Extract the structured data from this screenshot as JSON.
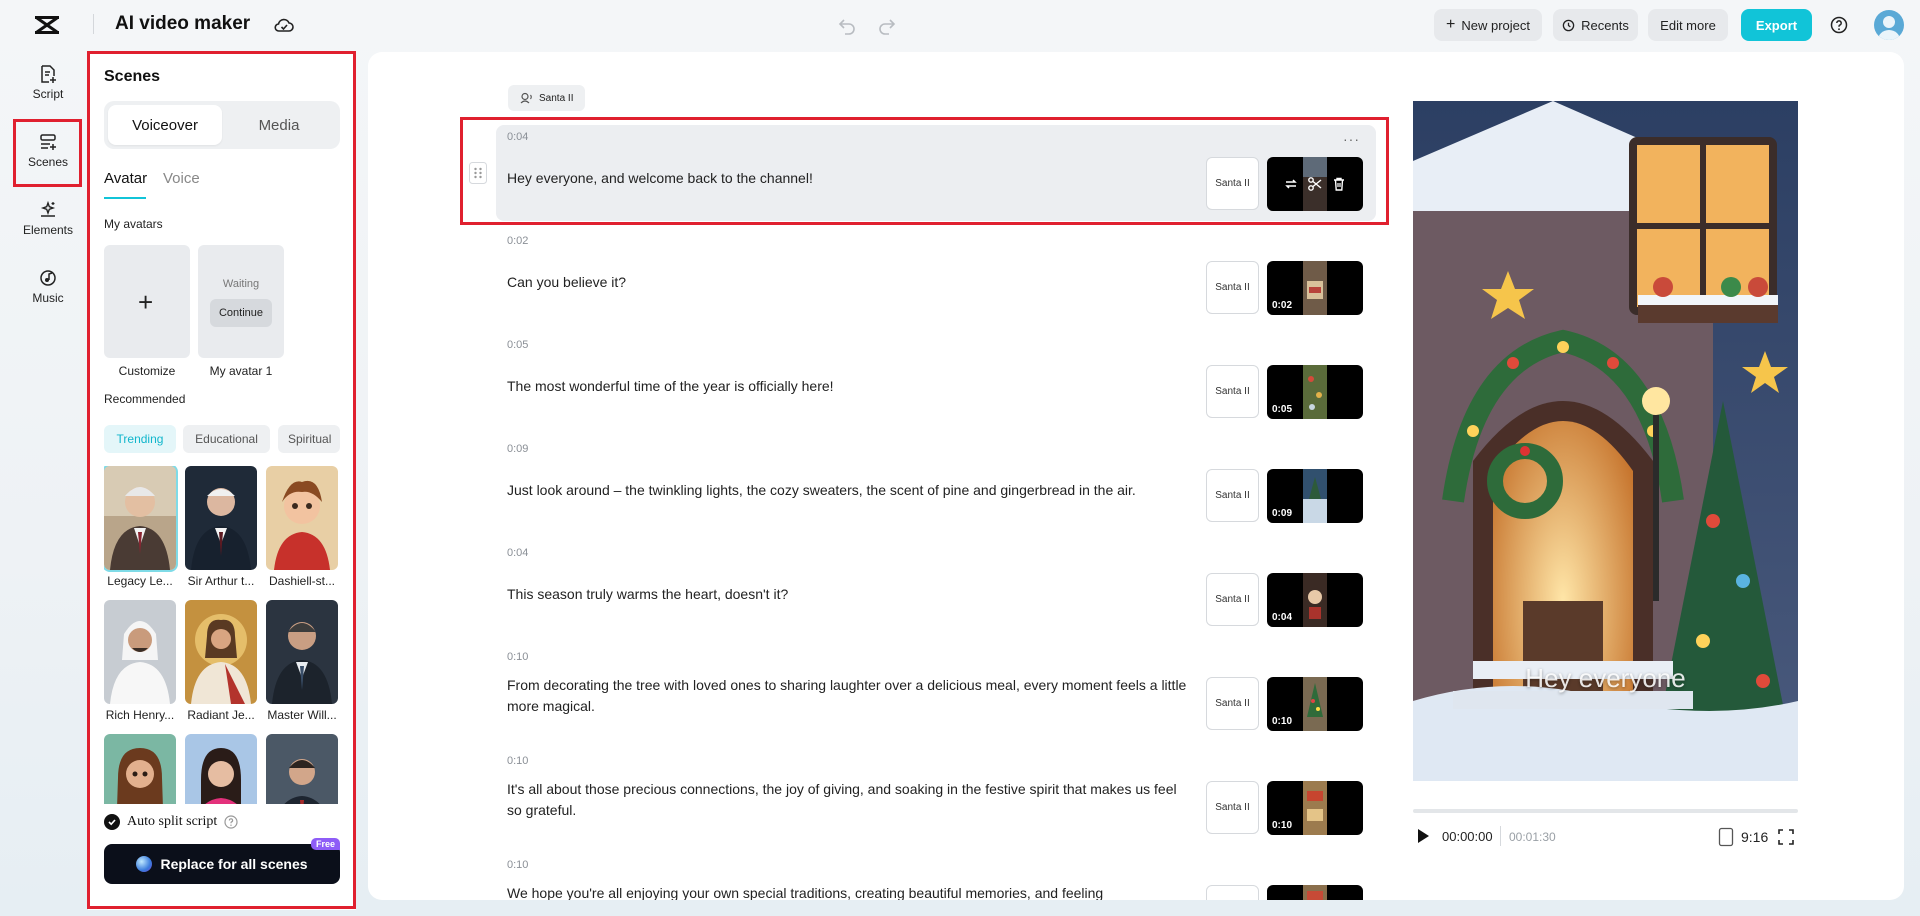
{
  "app": {
    "title": "AI video maker"
  },
  "topbar": {
    "new_project": "New project",
    "recents": "Recents",
    "edit_more": "Edit more",
    "export": "Export"
  },
  "rail": {
    "script": "Script",
    "scenes": "Scenes",
    "elements": "Elements",
    "music": "Music"
  },
  "panel": {
    "title": "Scenes",
    "segments": {
      "voiceover": "Voiceover",
      "media": "Media"
    },
    "subtabs": {
      "avatar": "Avatar",
      "voice": "Voice"
    },
    "my_avatars_label": "My avatars",
    "add_avatar_caption": "Customize",
    "waiting_text": "Waiting",
    "continue_label": "Continue",
    "my_avatar_caption": "My avatar 1",
    "recommended_label": "Recommended",
    "chips": {
      "trending": "Trending",
      "educational": "Educational",
      "spiritual": "Spiritual"
    },
    "avatars": [
      {
        "name": "Legacy Le..."
      },
      {
        "name": "Sir Arthur t..."
      },
      {
        "name": "Dashiell-st..."
      },
      {
        "name": "Rich Henry..."
      },
      {
        "name": "Radiant Je..."
      },
      {
        "name": "Master Will..."
      },
      {
        "name": ""
      },
      {
        "name": ""
      },
      {
        "name": ""
      }
    ],
    "auto_split": "Auto split script",
    "replace_button": "Replace for all scenes",
    "free_badge": "Free"
  },
  "script": {
    "voice_pill": "Santa II",
    "scenes": [
      {
        "time": "0:04",
        "text": "Hey everyone, and welcome back to the channel!",
        "voice": "Santa II",
        "duration": "",
        "active": true
      },
      {
        "time": "0:02",
        "text": "Can you believe it?",
        "voice": "Santa II",
        "duration": "0:02"
      },
      {
        "time": "0:05",
        "text": "The most wonderful time of the year is officially here!",
        "voice": "Santa II",
        "duration": "0:05"
      },
      {
        "time": "0:09",
        "text": "Just look around – the twinkling lights, the cozy sweaters, the scent of pine and gingerbread in the air.",
        "voice": "Santa II",
        "duration": "0:09"
      },
      {
        "time": "0:04",
        "text": "This season truly warms the heart, doesn't it?",
        "voice": "Santa II",
        "duration": "0:04"
      },
      {
        "time": "0:10",
        "text": "From decorating the tree with loved ones to sharing laughter over a delicious meal, every moment feels a little more magical.",
        "voice": "Santa II",
        "duration": "0:10"
      },
      {
        "time": "0:10",
        "text": "It's all about those precious connections, the joy of giving, and soaking in the festive spirit that makes us feel so grateful.",
        "voice": "Santa II",
        "duration": "0:10"
      },
      {
        "time": "0:10",
        "text": "We hope you're all enjoying your own special traditions, creating beautiful memories, and feeling",
        "voice": "",
        "duration": ""
      }
    ]
  },
  "preview": {
    "caption": "Hey everyone",
    "current_time": "00:00:00",
    "total_time": "00:01:30",
    "aspect_ratio": "9:16",
    "progress": 0
  },
  "colors": {
    "accent": "#11c4d8",
    "highlight": "#e0202f",
    "free_badge": "#8e5cf7"
  }
}
